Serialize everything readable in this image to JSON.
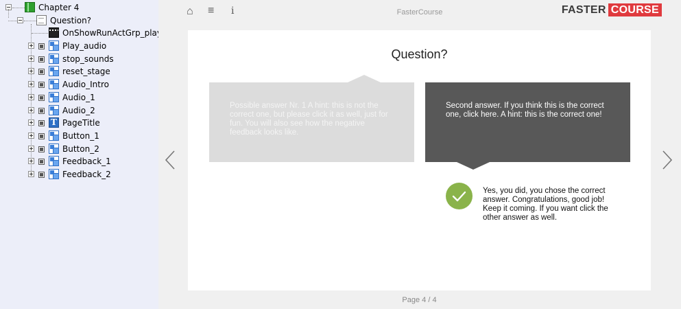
{
  "tree": {
    "chapter": "Chapter 4",
    "page": "Question?",
    "action": "OnShowRunActGrp_play",
    "items": [
      {
        "label": "Play_audio",
        "icon": "object-icon"
      },
      {
        "label": "stop_sounds",
        "icon": "object-icon"
      },
      {
        "label": "reset_stage",
        "icon": "object-icon"
      },
      {
        "label": "Audio_Intro",
        "icon": "object-icon"
      },
      {
        "label": "Audio_1",
        "icon": "object-icon"
      },
      {
        "label": "Audio_2",
        "icon": "object-icon"
      },
      {
        "label": "PageTitle",
        "icon": "text-icon"
      },
      {
        "label": "Button_1",
        "icon": "object-icon"
      },
      {
        "label": "Button_2",
        "icon": "object-icon"
      },
      {
        "label": "Feedback_1",
        "icon": "object-icon"
      },
      {
        "label": "Feedback_2",
        "icon": "object-icon"
      }
    ]
  },
  "toolbar": {
    "home_icon": "⌂",
    "menu_icon": "≡",
    "info_icon": "i",
    "title": "FasterCourse"
  },
  "brand": {
    "part1": "FASTER",
    "part2": "COURSE",
    "accent": "#e03a3e"
  },
  "slide": {
    "title": "Question?",
    "answer1": "Possible answer Nr. 1 A hint: this is not the correct one, but please click it as well, just for fun. You will also see how the negative feedback looks like.",
    "answer2": "Second answer. If you think this is the correct one, click here. A hint: this is the correct one!",
    "feedback": "Yes, you did, you chose the correct answer. Congratulations, good job! Keep it coming. If you want click the other answer as well.",
    "feedback_color": "#8ab34a"
  },
  "pager": "Page 4 / 4"
}
